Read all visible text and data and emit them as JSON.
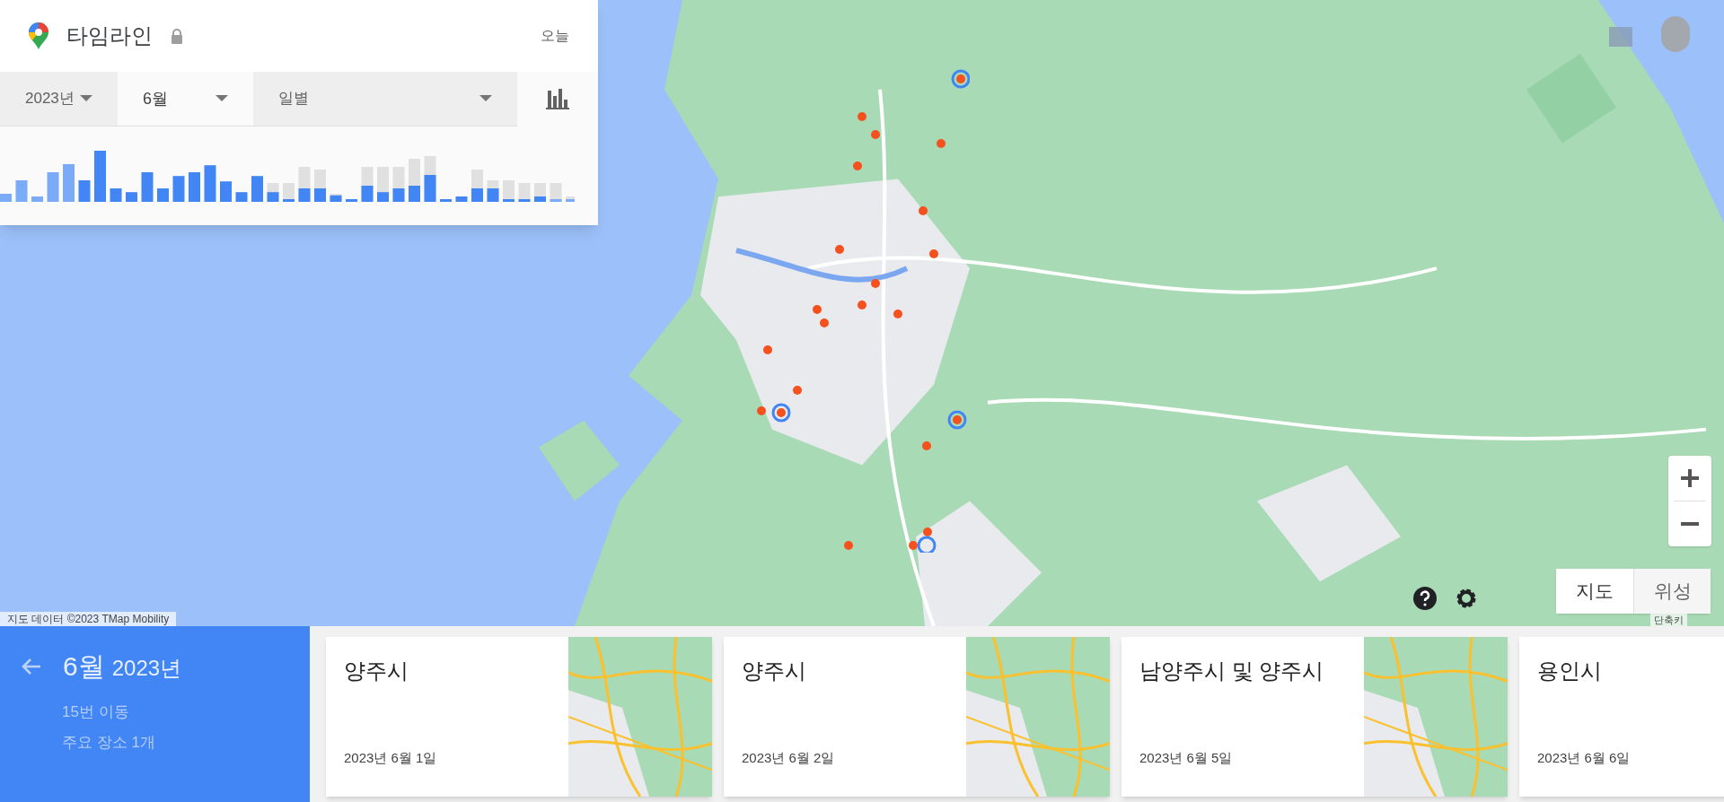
{
  "timeline": {
    "title": "타임라인",
    "today": "오늘",
    "filters": [
      {
        "label": "2023년"
      },
      {
        "label": "6월"
      },
      {
        "label": "일별"
      }
    ]
  },
  "map": {
    "kind": "picture",
    "attribution": "지도 데이터 ©2023 TMap Mobility",
    "shortcuts": "단축키",
    "map_types": [
      {
        "label": "지도",
        "selected": true
      },
      {
        "label": "위성",
        "selected": false
      }
    ]
  },
  "summary": {
    "month": "6월",
    "year": "2023년",
    "trips": "15번 이동",
    "places": "주요 장소 1개"
  },
  "days": [
    {
      "title": "양주시",
      "date": "2023년 6월 1일"
    },
    {
      "title": "양주시",
      "date": "2023년 6월 2일"
    },
    {
      "title": "남양주시 및 양주시",
      "date": "2023년 6월 5일"
    },
    {
      "title": "용인시",
      "date": "2023년 6월 6일"
    }
  ]
}
